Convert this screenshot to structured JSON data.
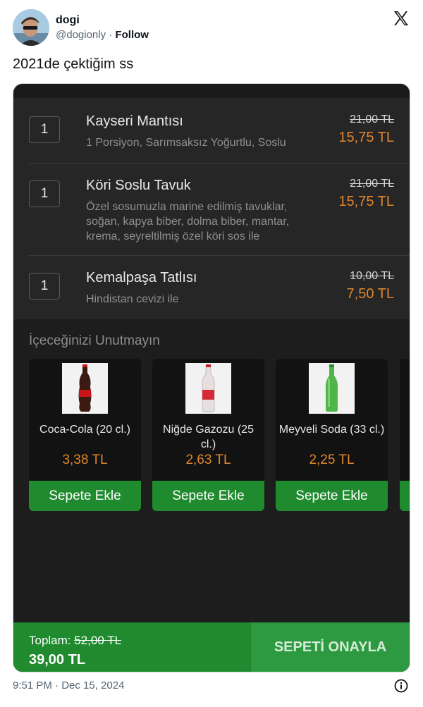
{
  "tweet": {
    "display_name": "dogi",
    "handle": "@dogionly",
    "separator": "·",
    "follow_label": "Follow",
    "text": "2021de çektiğim ss",
    "timestamp": "9:51 PM · Dec 15, 2024",
    "icons": {
      "avatar": "avatar",
      "logo": "x-logo-icon",
      "info": "info-icon"
    }
  },
  "order": {
    "items": [
      {
        "qty": "1",
        "name": "Kayseri Mantısı",
        "description": "1 Porsiyon, Sarımsaksız Yoğurtlu, Soslu",
        "old_price": "21,00 TL",
        "new_price": "15,75 TL"
      },
      {
        "qty": "1",
        "name": "Köri Soslu Tavuk",
        "description": "Özel sosumuzla marine edilmiş tavuklar, soğan, kapya biber, dolma biber, mantar, krema, seyreltilmiş özel köri sos ile",
        "old_price": "21,00 TL",
        "new_price": "15,75 TL"
      },
      {
        "qty": "1",
        "name": "Kemalpaşa Tatlısı",
        "description": "Hindistan cevizi ile",
        "old_price": "10,00 TL",
        "new_price": "7,50 TL"
      }
    ]
  },
  "drinks": {
    "title": "İçeceğinizi Unutmayın",
    "items": [
      {
        "name": "Coca-Cola (20 cl.)",
        "price": "3,38 TL",
        "button": "Sepete Ekle"
      },
      {
        "name": "Niğde Gazozu (25 cl.)",
        "price": "2,63 TL",
        "button": "Sepete Ekle"
      },
      {
        "name": "Meyveli Soda (33 cl.)",
        "price": "2,25 TL",
        "button": "Sepete Ekle"
      }
    ]
  },
  "cart": {
    "total_label": "Toplam:",
    "old_total": "52,00 TL",
    "new_total": "39,00 TL",
    "confirm_label": "SEPETİ ONAYLA"
  },
  "colors": {
    "accent_green": "#1f8a2e",
    "price_orange": "#e0862c",
    "dark_bg": "#1d1d1d"
  }
}
